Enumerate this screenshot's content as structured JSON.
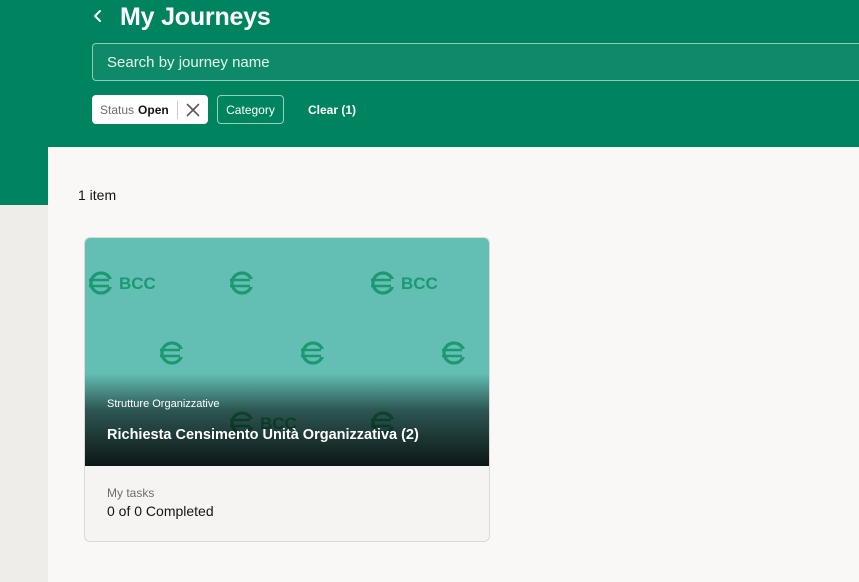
{
  "header": {
    "title": "My Journeys",
    "back_icon": "chevron-left-icon",
    "background_color": "#00835f"
  },
  "search": {
    "placeholder": "Search by journey name",
    "value": ""
  },
  "filters": {
    "status_label": "Status",
    "status_value": "Open",
    "remove_icon": "close-icon",
    "category_label": "Category",
    "clear_label": "Clear (1)"
  },
  "results": {
    "count_text": "1 item"
  },
  "cards": [
    {
      "image_logo_text": "BCC",
      "image_color": "#63bfb4",
      "logo_color": "#1b9a70",
      "category": "Strutture Organizzative",
      "title": "Richiesta Censimento Unità Organizzativa (2)",
      "tasks_label": "My tasks",
      "tasks_value": "0 of 0 Completed"
    }
  ]
}
